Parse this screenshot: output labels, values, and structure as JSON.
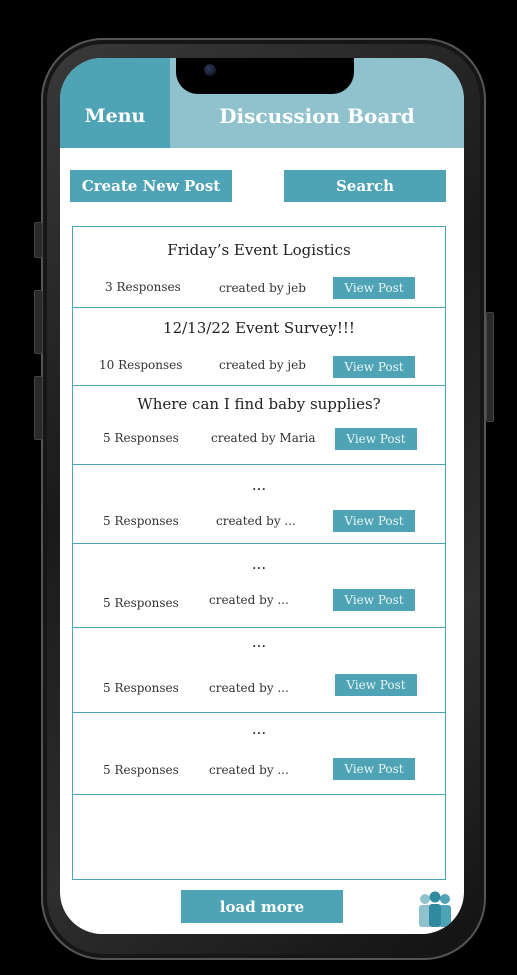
{
  "header": {
    "menu_label": "Menu",
    "title": "Discussion Board"
  },
  "toolbar": {
    "create_label": "Create New Post",
    "search_label": "Search"
  },
  "posts": [
    {
      "title": "Friday’s Event Logistics",
      "responses": "3 Responses",
      "author": "created by jeb",
      "view_label": "View Post"
    },
    {
      "title": "12/13/22 Event Survey!!!",
      "responses": "10 Responses",
      "author": "created by jeb",
      "view_label": "View Post"
    },
    {
      "title": "Where can I find baby supplies?",
      "responses": "5 Responses",
      "author": "created by Maria",
      "view_label": "View Post"
    },
    {
      "title": "...",
      "responses": "5 Responses",
      "author": "created by ...",
      "view_label": "View Post"
    },
    {
      "title": "...",
      "responses": "5 Responses",
      "author": "created by ...",
      "view_label": "View Post"
    },
    {
      "title": "...",
      "responses": "5 Responses",
      "author": "created by ...",
      "view_label": "View Post"
    },
    {
      "title": "...",
      "responses": "5 Responses",
      "author": "created by ...",
      "view_label": "View Post"
    }
  ],
  "footer": {
    "load_more_label": "load more",
    "icon": "users-icon"
  },
  "colors": {
    "accent": "#4ea3b5",
    "header_light": "#8fc2cc",
    "background": "#000000"
  }
}
